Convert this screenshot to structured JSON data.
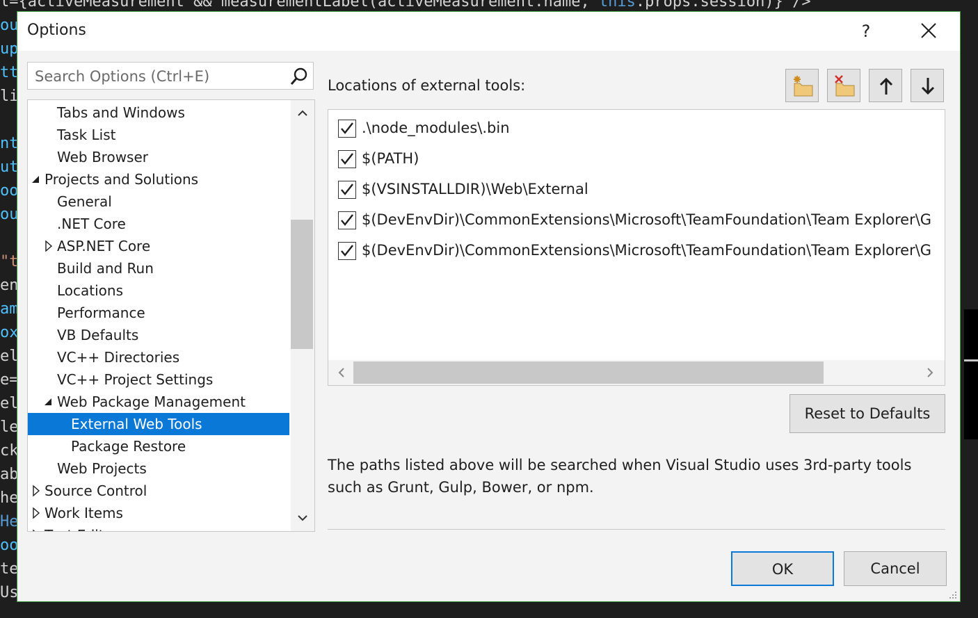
{
  "background_code": {
    "top_line": [
      {
        "text": "l={activeMeasurement && measurementLabel(activeMeasurement.name, ",
        "kind": "plain"
      },
      {
        "text": "this",
        "kind": "keyword"
      },
      {
        "text": ".props.session)} />",
        "kind": "plain"
      }
    ],
    "left_fragments": [
      {
        "text": "ou",
        "color": "#4fc1ff"
      },
      {
        "text": "up",
        "color": "#4fc1ff"
      },
      {
        "text": "tt",
        "color": "#4fc1ff"
      },
      {
        "text": "li",
        "color": "#d4d4d4"
      },
      {
        "text": "",
        "color": "#d4d4d4"
      },
      {
        "text": "nt",
        "color": "#4fc1ff"
      },
      {
        "text": "ut",
        "color": "#4fc1ff"
      },
      {
        "text": "oo",
        "color": "#4fc1ff"
      },
      {
        "text": "ou",
        "color": "#4fc1ff"
      },
      {
        "text": "",
        "color": "#d4d4d4"
      },
      {
        "text": "\"t",
        "color": "#ce9178"
      },
      {
        "text": "en",
        "color": "#d4d4d4"
      },
      {
        "text": "am",
        "color": "#4fc1ff"
      },
      {
        "text": "ox",
        "color": "#4fc1ff"
      },
      {
        "text": "el",
        "color": "#d4d4d4"
      },
      {
        "text": "e=",
        "color": "#d4d4d4"
      },
      {
        "text": "el",
        "color": "#d4d4d4"
      },
      {
        "text": "le",
        "color": "#d4d4d4"
      },
      {
        "text": "ck",
        "color": "#d4d4d4"
      },
      {
        "text": "ab",
        "color": "#d4d4d4"
      },
      {
        "text": "he",
        "color": "#d4d4d4"
      },
      {
        "text": "He",
        "color": "#569cd6"
      },
      {
        "text": "oo",
        "color": "#4fc1ff"
      },
      {
        "text": "te",
        "color": "#d4d4d4"
      },
      {
        "text": "Us",
        "color": "#d4d4d4"
      }
    ]
  },
  "dialog": {
    "title": "Options",
    "help_label": "?",
    "search": {
      "placeholder": "Search Options (Ctrl+E)",
      "value": ""
    },
    "tree": [
      {
        "label": "Tabs and Windows",
        "level": 2,
        "expander": "none",
        "selected": false
      },
      {
        "label": "Task List",
        "level": 2,
        "expander": "none",
        "selected": false
      },
      {
        "label": "Web Browser",
        "level": 2,
        "expander": "none",
        "selected": false
      },
      {
        "label": "Projects and Solutions",
        "level": 1,
        "expander": "expanded",
        "selected": false
      },
      {
        "label": "General",
        "level": 2,
        "expander": "none",
        "selected": false
      },
      {
        "label": ".NET Core",
        "level": 2,
        "expander": "none",
        "selected": false
      },
      {
        "label": "ASP.NET Core",
        "level": 2,
        "expander": "collapsed",
        "selected": false
      },
      {
        "label": "Build and Run",
        "level": 2,
        "expander": "none",
        "selected": false
      },
      {
        "label": "Locations",
        "level": 2,
        "expander": "none",
        "selected": false
      },
      {
        "label": "Performance",
        "level": 2,
        "expander": "none",
        "selected": false
      },
      {
        "label": "VB Defaults",
        "level": 2,
        "expander": "none",
        "selected": false
      },
      {
        "label": "VC++ Directories",
        "level": 2,
        "expander": "none",
        "selected": false
      },
      {
        "label": "VC++ Project Settings",
        "level": 2,
        "expander": "none",
        "selected": false
      },
      {
        "label": "Web Package Management",
        "level": 2,
        "expander": "expanded",
        "selected": false
      },
      {
        "label": "External Web Tools",
        "level": 3,
        "expander": "none",
        "selected": true
      },
      {
        "label": "Package Restore",
        "level": 3,
        "expander": "none",
        "selected": false
      },
      {
        "label": "Web Projects",
        "level": 2,
        "expander": "none",
        "selected": false
      },
      {
        "label": "Source Control",
        "level": 1,
        "expander": "collapsed",
        "selected": false
      },
      {
        "label": "Work Items",
        "level": 1,
        "expander": "collapsed",
        "selected": false
      },
      {
        "label": "Text Editor",
        "level": 1,
        "expander": "collapsed",
        "selected": false
      }
    ],
    "locations_label": "Locations of external tools:",
    "toolbar": [
      {
        "name": "new-location-button",
        "icon": "new-folder-icon",
        "tooltip": "New"
      },
      {
        "name": "delete-location-button",
        "icon": "delete-folder-icon",
        "tooltip": "Delete"
      },
      {
        "name": "move-up-button",
        "icon": "arrow-up-icon",
        "tooltip": "Move Up"
      },
      {
        "name": "move-down-button",
        "icon": "arrow-down-icon",
        "tooltip": "Move Down"
      }
    ],
    "locations": [
      {
        "path": ".\\node_modules\\.bin",
        "checked": true
      },
      {
        "path": "$(PATH)",
        "checked": true
      },
      {
        "path": "$(VSINSTALLDIR)\\Web\\External",
        "checked": true
      },
      {
        "path": "$(DevEnvDir)\\CommonExtensions\\Microsoft\\TeamFoundation\\Team Explorer\\G",
        "checked": true
      },
      {
        "path": "$(DevEnvDir)\\CommonExtensions\\Microsoft\\TeamFoundation\\Team Explorer\\G",
        "checked": true
      }
    ],
    "reset_label": "Reset to Defaults",
    "description": "The paths listed above will be searched when Visual Studio uses 3rd-party tools such as Grunt, Gulp, Bower, or npm.",
    "ok_label": "OK",
    "cancel_label": "Cancel",
    "colors": {
      "accent": "#0a78d7",
      "border": "#3c9b3c",
      "folder": "#f0c87a",
      "delete": "#d0312d"
    }
  }
}
